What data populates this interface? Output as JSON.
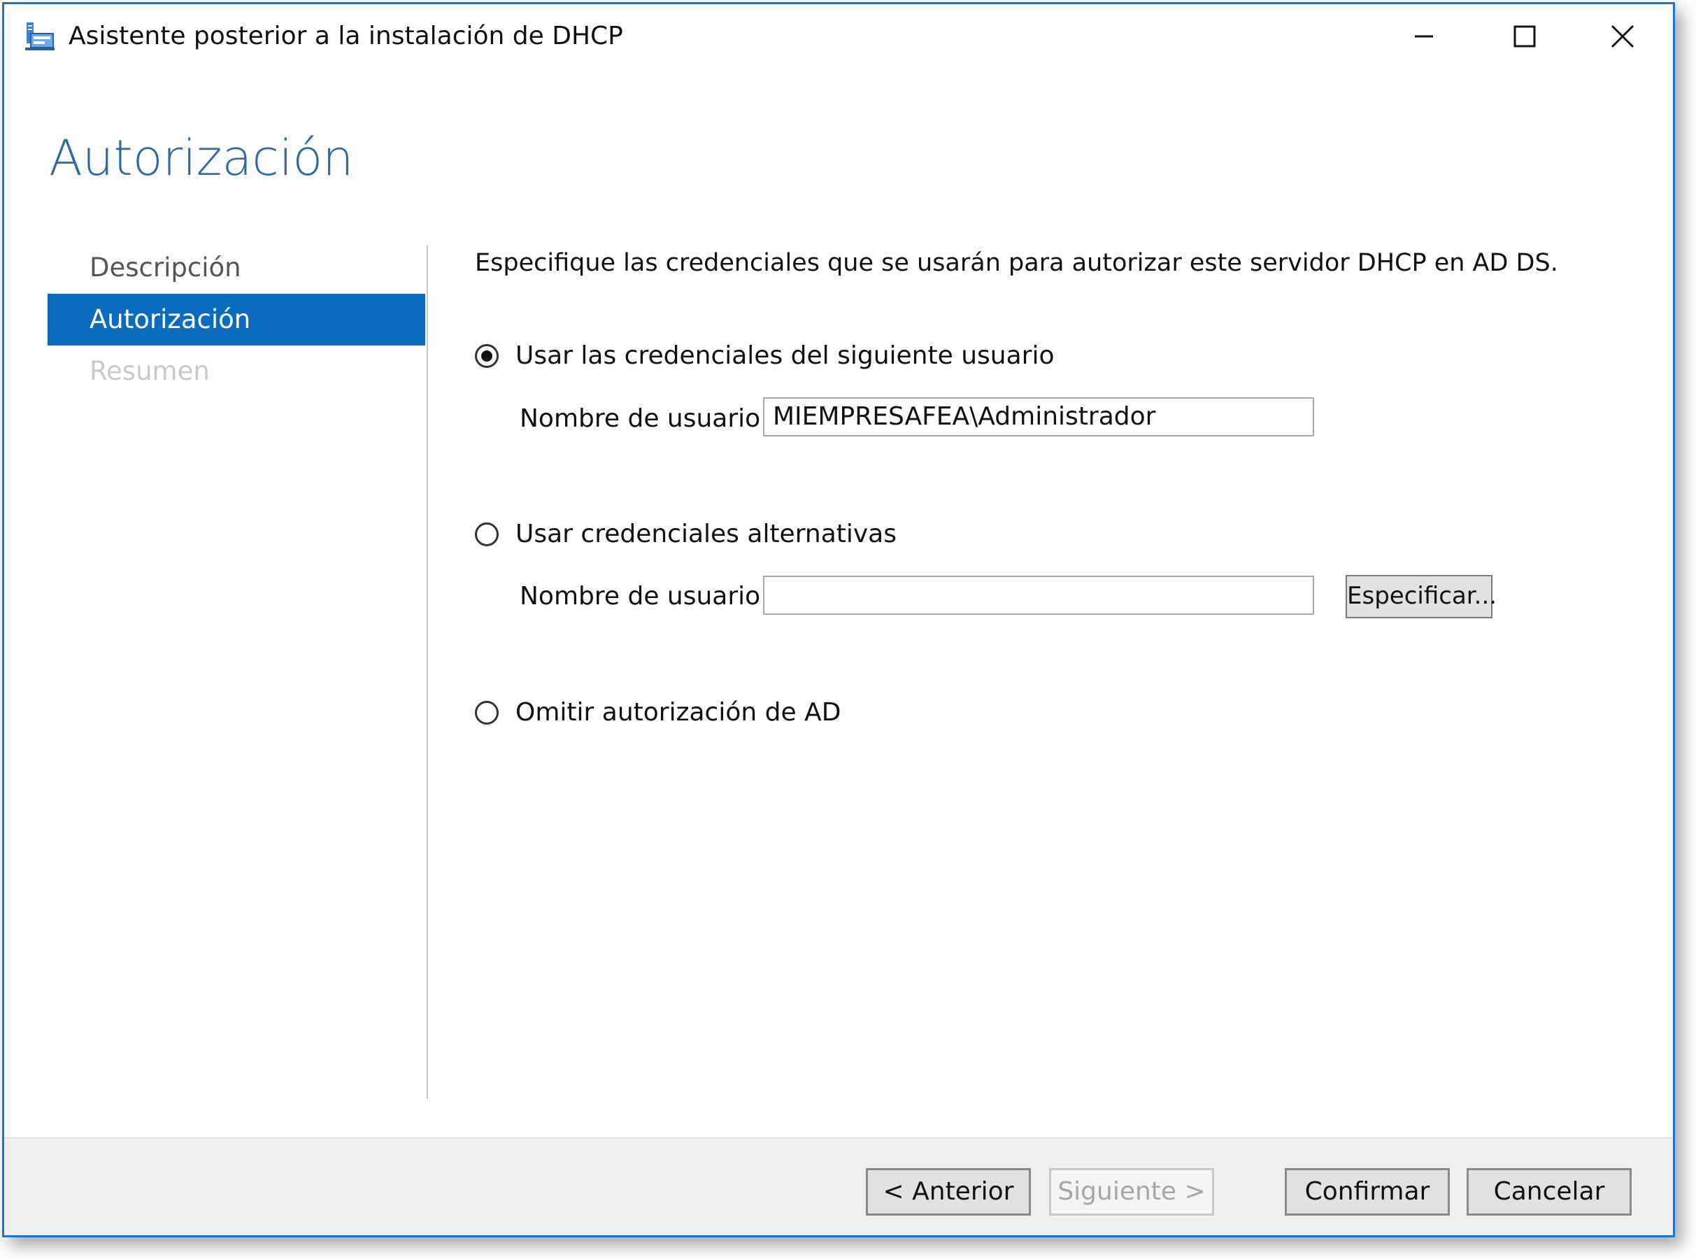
{
  "window": {
    "title": "Asistente posterior a la instalación de DHCP",
    "controls": [
      "minimize-icon",
      "maximize-icon",
      "close-icon"
    ],
    "accent_color": "#1e74c8"
  },
  "page": {
    "title": "Autorización",
    "title_color": "#2b6aa6"
  },
  "nav": {
    "items": [
      {
        "label": "Descripción",
        "state": "normal"
      },
      {
        "label": "Autorización",
        "state": "selected"
      },
      {
        "label": "Resumen",
        "state": "disabled"
      }
    ],
    "selected_color": "#0a6cbf"
  },
  "content": {
    "instruction": "Especifique las credenciales que se usarán para autorizar este servidor DHCP en AD DS.",
    "options": [
      {
        "label": "Usar las credenciales del siguiente usuario",
        "checked": true
      },
      {
        "label": "Usar credenciales alternativas",
        "checked": false
      },
      {
        "label": "Omitir autorización de AD",
        "checked": false
      }
    ],
    "user_field_1": {
      "label": "Nombre de usuario:",
      "value": "MIEMPRESAFEA\\Administrador"
    },
    "user_field_2": {
      "label": "Nombre de usuario:",
      "value": ""
    },
    "specify_button": "Especificar..."
  },
  "footer": {
    "previous": "< Anterior",
    "next": "Siguiente >",
    "confirm": "Confirmar",
    "cancel": "Cancelar"
  }
}
